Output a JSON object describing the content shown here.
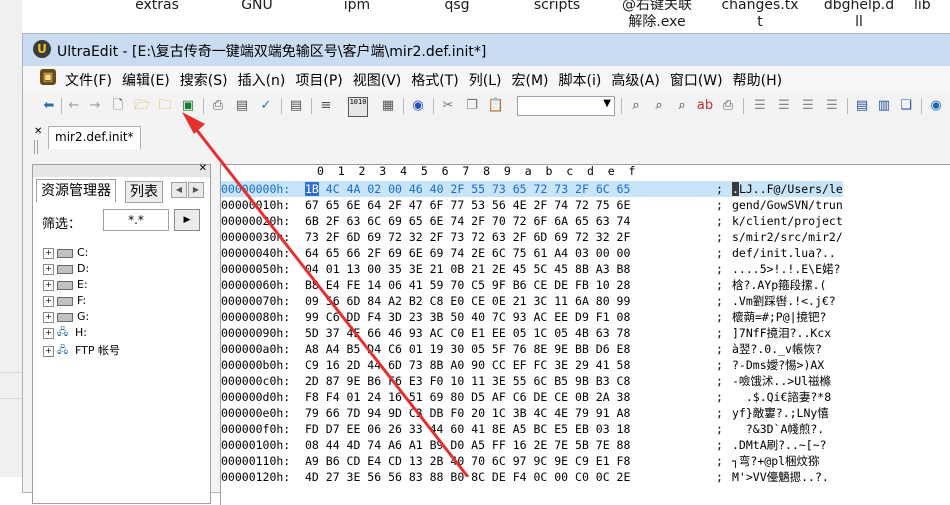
{
  "desktop": {
    "items": [
      "extras",
      "GNU",
      "ipm",
      "qsg",
      "scripts",
      "@右键关联\n解除.exe",
      "changes.tx\nt",
      "dbghelp.d\nll",
      "lib"
    ]
  },
  "window": {
    "title": "UltraEdit - [E:\\复古传奇一键端双端免输区号\\客户端\\mir2.def.init*]"
  },
  "menu": {
    "items": [
      "文件(F)",
      "编辑(E)",
      "搜索(S)",
      "插入(n)",
      "项目(P)",
      "视图(V)",
      "格式(T)",
      "列(L)",
      "宏(M)",
      "脚本(i)",
      "高级(A)",
      "窗口(W)",
      "帮助(H)"
    ]
  },
  "toolbar": {
    "buttons": [
      "import-icon",
      "back-arrow-icon",
      "forward-arrow-icon",
      "new-file-icon",
      "open-folder-icon",
      "open-recent-folder-icon",
      "save-icon",
      "print-icon",
      "print-preview-icon",
      "spell-check-icon",
      "document-icon",
      "word-wrap-icon",
      "hex-mode-icon",
      "properties-icon",
      "web-browser-icon",
      "cut-icon",
      "copy-icon",
      "paste-icon",
      "find-icon",
      "find-next-icon",
      "find-prev-icon",
      "replace-icon",
      "printer-icon",
      "align-left-icon",
      "align-center-icon",
      "align-right-icon",
      "justify-icon",
      "split-horizontal-icon",
      "split-vertical-icon",
      "cascade-windows-icon",
      "globe-icon"
    ],
    "combo_value": ""
  },
  "document_tab": {
    "label": "mir2.def.init*"
  },
  "file_panel": {
    "tab_explorer": "资源管理器",
    "tab_list": "列表",
    "filter_label": "筛选：",
    "filter_value": "*.*",
    "drives": [
      "C:",
      "D:",
      "E:",
      "F:",
      "G:",
      "H:",
      "FTP 帐号"
    ]
  },
  "hex_view": {
    "columns": "0  1  2  3  4  5  6  7  8  9  a  b  c  d  e  f",
    "selected_byte": "1B",
    "rows": [
      {
        "addr": "00000000h:",
        "bytes": "4C 4A 02 00 46 40 2F 55 73 65 72 73 2F 6C 65",
        "ascii": "LJ..F@/Users/le"
      },
      {
        "addr": "00000010h:",
        "bytes": "67 65 6E 64 2F 47 6F 77 53 56 4E 2F 74 72 75 6E",
        "ascii": "gend/GowSVN/trun"
      },
      {
        "addr": "00000020h:",
        "bytes": "6B 2F 63 6C 69 65 6E 74 2F 70 72 6F 6A 65 63 74",
        "ascii": "k/client/project"
      },
      {
        "addr": "00000030h:",
        "bytes": "73 2F 6D 69 72 32 2F 73 72 63 2F 6D 69 72 32 2F",
        "ascii": "s/mir2/src/mir2/"
      },
      {
        "addr": "00000040h:",
        "bytes": "64 65 66 2F 69 6E 69 74 2E 6C 75 61 A4 03 00 00",
        "ascii": "def/init.lua?.."
      },
      {
        "addr": "00000050h:",
        "bytes": "04 01 13 00 35 3E 21 0B 21 2E 45 5C 45 8B A3 B8",
        "ascii": "....5>!.!.E\\E婼?"
      },
      {
        "addr": "00000060h:",
        "bytes": "B8 E4 FE 14 06 41 59 70 C5 9F B6 CE DE FB 10 28",
        "ascii": "梒?.AYp箍段摞.("
      },
      {
        "addr": "00000070h:",
        "bytes": "09 56 6D 84 A2 B2 C8 E0 CE 0E 21 3C 11 6A 80 99",
        "ascii": ".Vm劉踩辔.!<.j€?"
      },
      {
        "addr": "00000080h:",
        "bytes": "99 C6 DD F4 3D 23 3B 50 40 7C 93 AC EE D9 F1 08",
        "ascii": "櫰蒴=#;P@|摬钯?"
      },
      {
        "addr": "00000090h:",
        "bytes": "5D 37 4E 66 46 93 AC C0 E1 EE 05 1C 05 4B 63 78",
        "ascii": "]7NfF摬泪?..Kcx"
      },
      {
        "addr": "000000a0h:",
        "bytes": "A8 A4 B5 D4 C6 01 19 30 05 5F 76 8E 9E BB D6 E8",
        "ascii": "à翌?.0._v帳恢?"
      },
      {
        "addr": "000000b0h:",
        "bytes": "C9 16 2D 44 6D 73 8B A0 90 CC EF FC 3E 29 41 58",
        "ascii": "?-Dms嬡?惕>)AX"
      },
      {
        "addr": "000000c0h:",
        "bytes": "2D 87 9E B6 F6 E3 F0 10 11 3E 55 6C B5 9B B3 C8",
        "ascii": "-噞饿沭..>Ul禌樤"
      },
      {
        "addr": "000000d0h:",
        "bytes": "F8 F4 01 24 16 51 69 80 D5 AF C6 DE CE 0B 2A 38",
        "ascii": "  .$.Qi€諮妻?*8"
      },
      {
        "addr": "000000e0h:",
        "bytes": "79 66 7D 94 9D C3 DB F0 20 1C 3B 4C 4E 79 91 A8",
        "ascii": "yf}敵寠?.;LNy憘"
      },
      {
        "addr": "000000f0h:",
        "bytes": "FD D7 EE 06 26 33 44 60 41 8E A5 BC E5 EB 03 18",
        "ascii": "  ?&3D`A帴煎?."
      },
      {
        "addr": "00000100h:",
        "bytes": "08 44 4D 74 A6 A1 B9 D0 A5 FF 16 2E 7E 5B 7E 88",
        "ascii": ".DMtA刷?..~[~?"
      },
      {
        "addr": "00000110h:",
        "bytes": "A9 B6 CD E4 CD 13 2B 40 70 6C 97 9C 9E C9 E1 F8",
        "ascii": "┐弯?+@pl梱炆猕"
      },
      {
        "addr": "00000120h:",
        "bytes": "4D 27 3E 56 56 83 88 B0 8C DE F4 0C 00 C0 0C 2E",
        "ascii": "M'>VV儓魉摁..?."
      }
    ]
  },
  "colors": {
    "selection": "#c8e4f8",
    "accent": "#1b6ad0",
    "arrow": "#e53030"
  }
}
